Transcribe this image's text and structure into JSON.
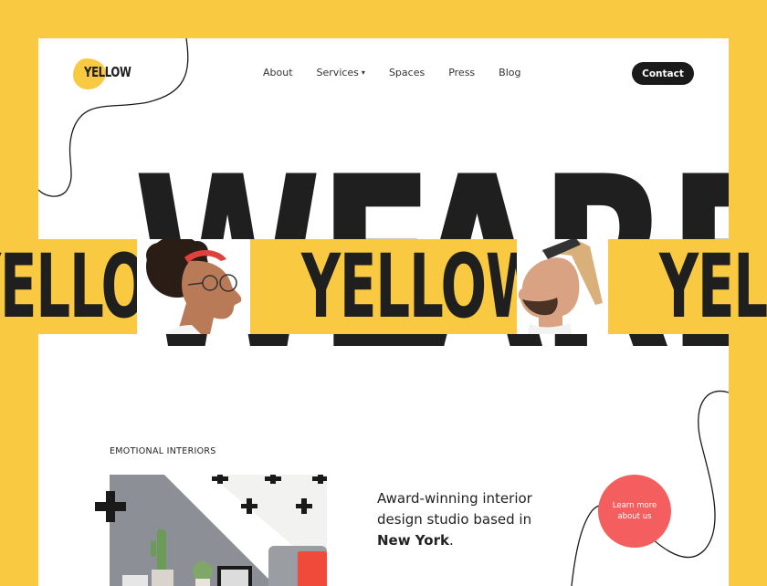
{
  "brand": {
    "name": "YELLOW"
  },
  "nav": {
    "items": [
      {
        "label": "About"
      },
      {
        "label": "Services"
      },
      {
        "label": "Spaces"
      },
      {
        "label": "Press"
      },
      {
        "label": "Blog"
      }
    ],
    "contact_label": "Contact"
  },
  "hero": {
    "word_left": "WE",
    "word_right": "ARE",
    "band_words": [
      "YELLOW",
      "YELLOW",
      "YELLOW"
    ]
  },
  "section": {
    "label": "EMOTIONAL INTERIORS",
    "tagline_line1": "Award-winning interior",
    "tagline_line2": "design studio based in",
    "tagline_city": "New York",
    "tagline_end": ".",
    "cta_line1": "Learn more",
    "cta_line2": "about us"
  },
  "colors": {
    "accent": "#F9C941",
    "ink": "#1f1f1f",
    "cta": "#F45E5E"
  }
}
